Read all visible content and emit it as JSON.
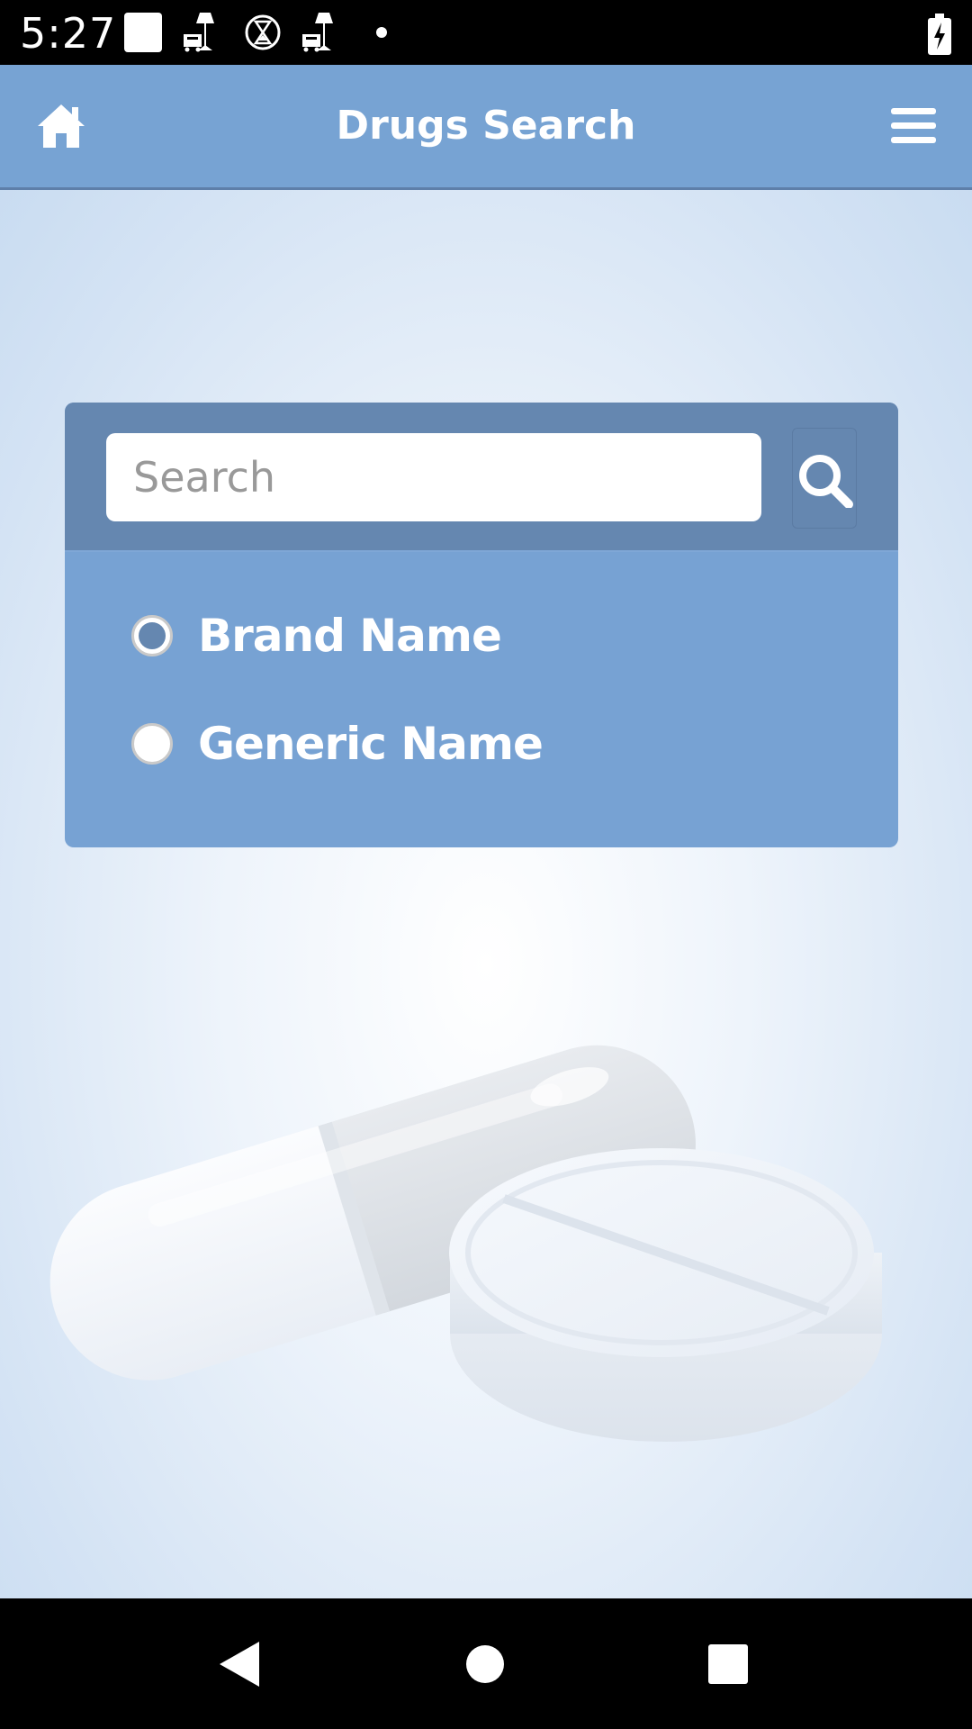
{
  "status_bar": {
    "time": "5:27",
    "icons": [
      "square-notification-icon",
      "lamp-cart-icon",
      "hourglass-icon",
      "lamp-cart-icon",
      "dot-icon",
      "battery-charging-icon"
    ]
  },
  "app_bar": {
    "title": "Drugs Search",
    "left_icon": "home-icon",
    "right_icon": "hamburger-menu-icon"
  },
  "search_card": {
    "search": {
      "placeholder": "Search",
      "value": "",
      "button_icon": "search-icon"
    },
    "options": [
      {
        "label": "Brand Name",
        "checked": true
      },
      {
        "label": "Generic Name",
        "checked": false
      }
    ]
  },
  "background_art": "capsule-and-tablet-pills-illustration",
  "nav_bar": {
    "buttons": [
      "back-icon",
      "home-circle-icon",
      "recents-square-icon"
    ]
  },
  "colors": {
    "app_bar": "#77a3d3",
    "card_header": "#6587b0",
    "card_body": "#77a2d3",
    "status_bar": "#000000"
  }
}
